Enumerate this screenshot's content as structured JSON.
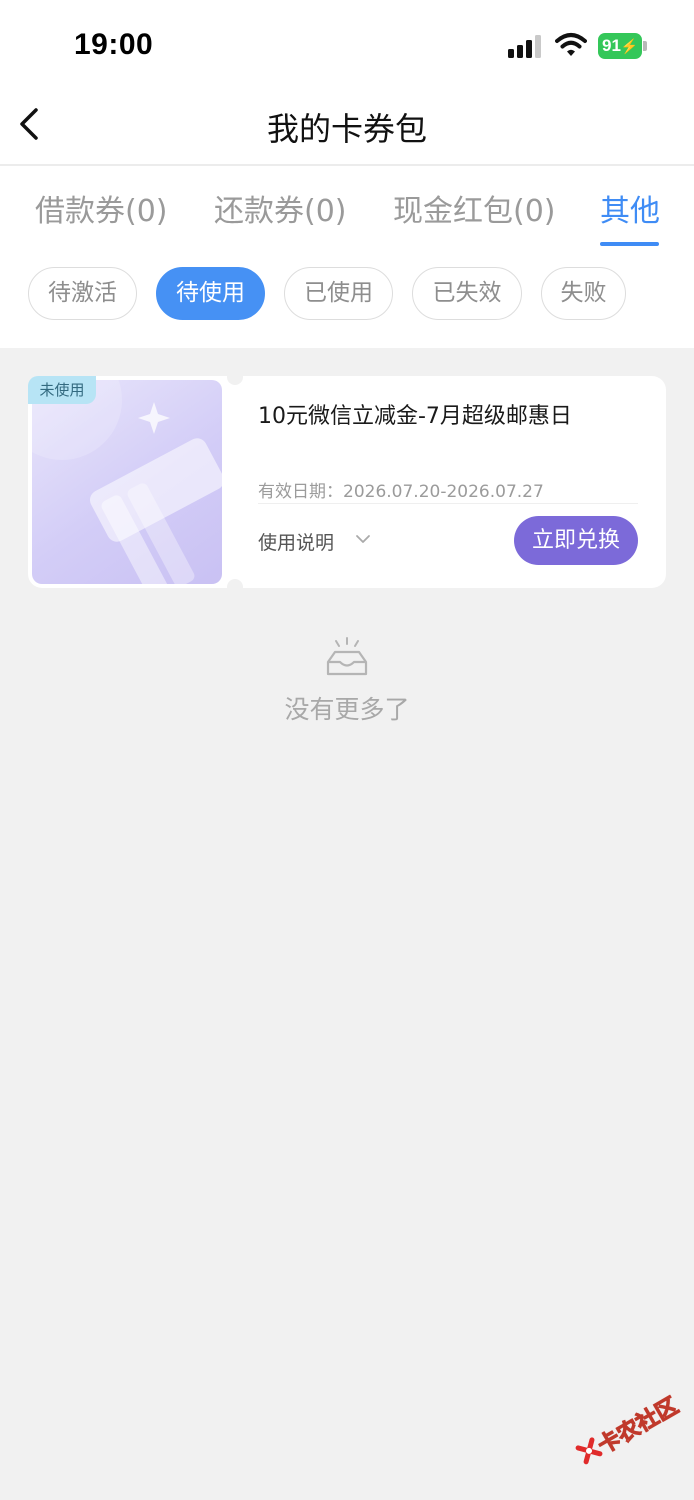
{
  "status_bar": {
    "time": "19:00",
    "battery": "91"
  },
  "header": {
    "title": "我的卡券包"
  },
  "tabs": [
    {
      "label": "借款券(0)"
    },
    {
      "label": "还款券(0)"
    },
    {
      "label": "现金红包(0)"
    },
    {
      "label": "其他"
    }
  ],
  "filters": [
    {
      "label": "待激活"
    },
    {
      "label": "待使用"
    },
    {
      "label": "已使用"
    },
    {
      "label": "已失效"
    },
    {
      "label": "失败"
    }
  ],
  "coupon": {
    "badge": "未使用",
    "name": "10元微信立减金-7月超级邮惠日",
    "validity": "有效日期：2026.07.20-2026.07.27",
    "usage_label": "使用说明",
    "redeem_label": "立即兑换"
  },
  "empty": {
    "text": "没有更多了"
  },
  "watermark": {
    "text": "卡农社区"
  },
  "colors": {
    "accent_blue": "#3f8cf5",
    "redeem_purple": "#7c6ad9",
    "battery_green": "#34c759",
    "badge_cyan": "#b7e4f5"
  }
}
